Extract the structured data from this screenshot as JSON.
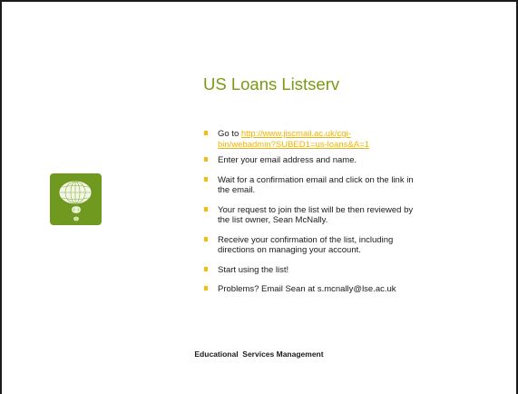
{
  "slide": {
    "title": "US Loans Listserv",
    "footer": "Educational  Services Management",
    "logo_icon": "globe-icon",
    "colors": {
      "title": "#7a9a12",
      "logo_background": "#6f9a1f",
      "bullet_marker": "#f4be0c",
      "link": "#f0b400"
    },
    "bullets": [
      {
        "prefix": "Go to ",
        "link_line1": "http://www.jiscmail.ac.uk/cgi-",
        "link_line2": "bin/webadmin?SUBED1=us-loans&A=1"
      },
      {
        "line1": "Enter your email address and name."
      },
      {
        "line1": "Wait for a confirmation email and click on the link in",
        "line2": "the email."
      },
      {
        "line1": "Your request to join the list will be then reviewed by",
        "line2": "the list owner, Sean McNally."
      },
      {
        "line1": "Receive your confirmation of the list, including",
        "line2": "directions on managing your account."
      },
      {
        "line1": "Start using the list!"
      },
      {
        "line1": "Problems? Email Sean at s.mcnally@lse.ac.uk"
      }
    ]
  }
}
